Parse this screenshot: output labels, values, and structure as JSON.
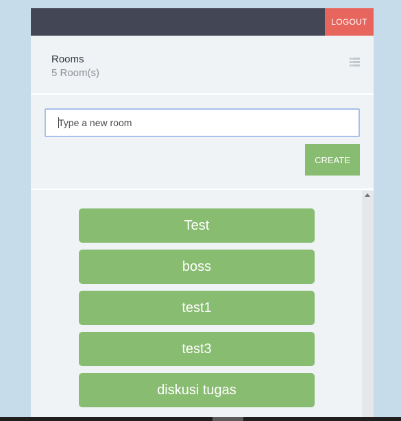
{
  "topbar": {
    "logout_label": "LOGOUT"
  },
  "header": {
    "title": "Rooms",
    "room_count": "5 Room(s)",
    "list_icon": "list-view-icon"
  },
  "new_room": {
    "placeholder": "Type a new room",
    "value": "",
    "create_label": "CREATE"
  },
  "rooms": [
    {
      "label": "Test"
    },
    {
      "label": "boss"
    },
    {
      "label": "test1"
    },
    {
      "label": "test3"
    },
    {
      "label": "diskusi tugas"
    }
  ],
  "colors": {
    "topbar": "#434654",
    "logout": "#e8655d",
    "accent_green": "#88bc71",
    "panel": "#eff3f6",
    "page_background": "#c7dceb"
  }
}
